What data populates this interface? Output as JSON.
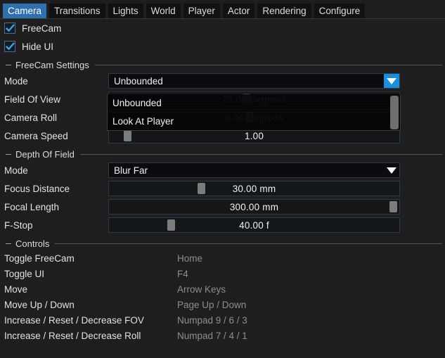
{
  "tabs": [
    {
      "label": "Camera",
      "active": true
    },
    {
      "label": "Transitions",
      "active": false
    },
    {
      "label": "Lights",
      "active": false
    },
    {
      "label": "World",
      "active": false
    },
    {
      "label": "Player",
      "active": false
    },
    {
      "label": "Actor",
      "active": false
    },
    {
      "label": "Rendering",
      "active": false
    },
    {
      "label": "Configure",
      "active": false
    }
  ],
  "toggles": [
    {
      "label": "FreeCam",
      "checked": true
    },
    {
      "label": "Hide UI",
      "checked": true
    }
  ],
  "freecam": {
    "section_title": "FreeCam Settings",
    "mode": {
      "label": "Mode",
      "value": "Unbounded",
      "expanded": true,
      "options": [
        "Unbounded",
        "Look At Player"
      ]
    },
    "field_of_view": {
      "label": "Field Of View",
      "value": "75.00 Degrees"
    },
    "camera_roll": {
      "label": "Camera Roll",
      "value": "0.00 Degrees"
    },
    "camera_speed": {
      "label": "Camera Speed",
      "value": "1.00"
    }
  },
  "depth_of_field": {
    "section_title": "Depth Of Field",
    "mode": {
      "label": "Mode",
      "value": "Blur Far"
    },
    "focus_distance": {
      "label": "Focus Distance",
      "value": "30.00 mm"
    },
    "focal_length": {
      "label": "Focal Length",
      "value": "300.00 mm"
    },
    "f_stop": {
      "label": "F-Stop",
      "value": "40.00 f"
    }
  },
  "controls": {
    "section_title": "Controls",
    "bindings": [
      {
        "action": "Toggle FreeCam",
        "keys": "Home"
      },
      {
        "action": "Toggle UI",
        "keys": "F4"
      },
      {
        "action": "Move",
        "keys": "Arrow Keys"
      },
      {
        "action": "Move Up / Down",
        "keys": "Page Up / Down"
      },
      {
        "action": "Increase / Reset / Decrease FOV",
        "keys": "Numpad 9 / 6 / 3"
      },
      {
        "action": "Increase / Reset / Decrease Roll",
        "keys": "Numpad 7 / 4 / 1"
      }
    ]
  },
  "colors": {
    "background": "#1e1e1e",
    "tab_active": "#2f6fae",
    "accent_blue": "#1a8fe0",
    "checkbox_border": "#3f6f9b",
    "field_border": "#2b3a4a",
    "text": "#e2e2e2",
    "muted_text": "#8e8e8e"
  }
}
